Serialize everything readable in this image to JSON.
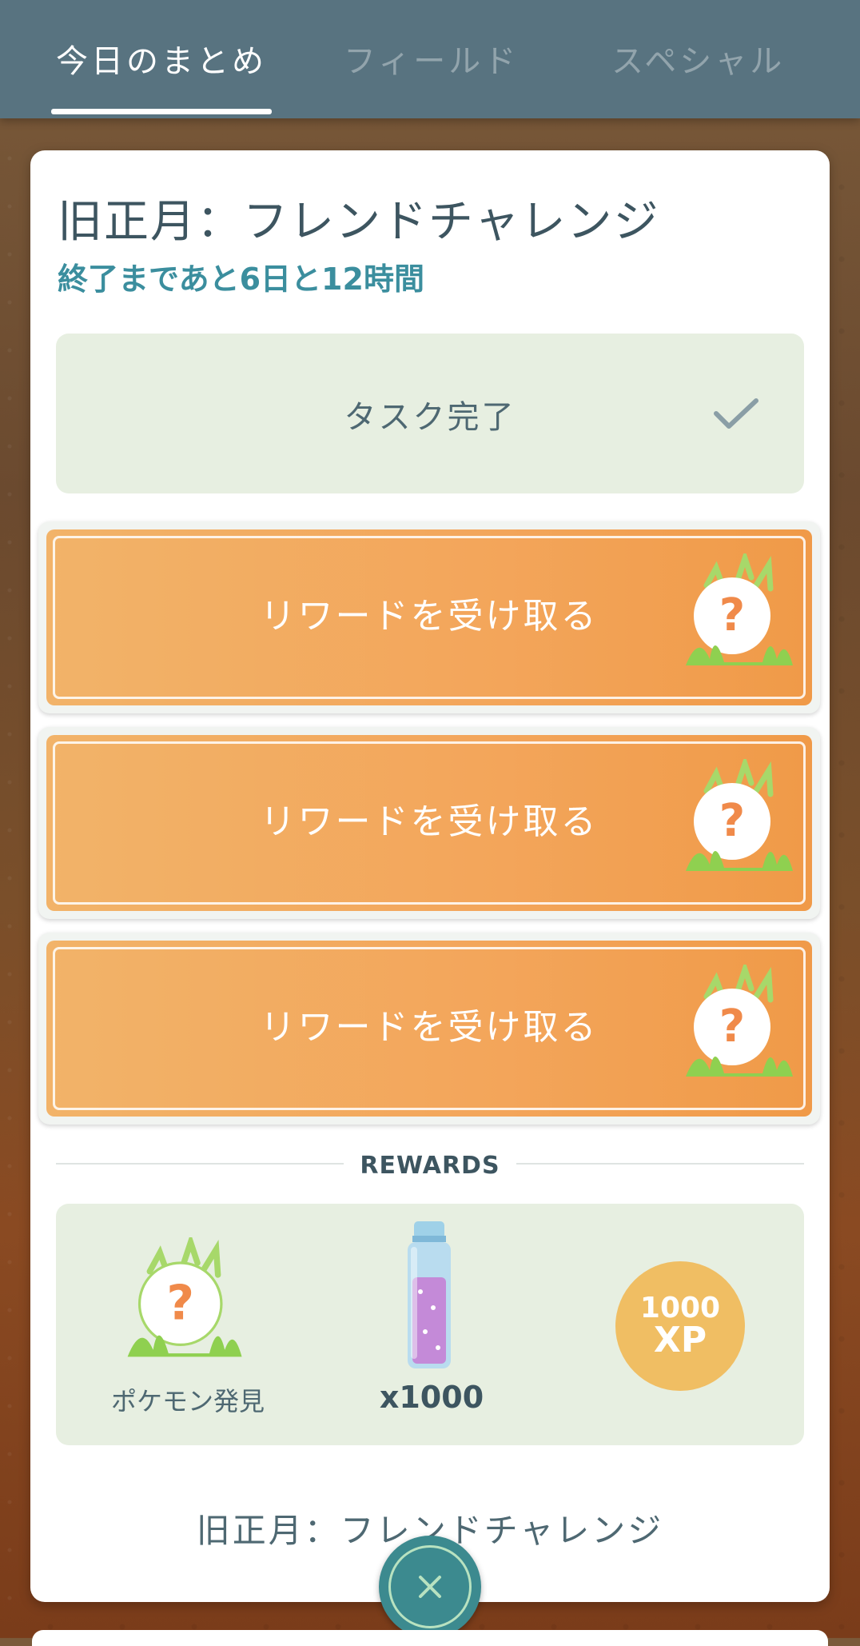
{
  "tabs": [
    {
      "label": "今日のまとめ",
      "active": true
    },
    {
      "label": "フィールド",
      "active": false
    },
    {
      "label": "スペシャル",
      "active": false
    }
  ],
  "card": {
    "title": "旧正月：フレンドチャレンジ",
    "time_remaining": "終了まであと6日と12時間",
    "task_status": "タスク完了",
    "reward_buttons": [
      {
        "label": "リワードを受け取る",
        "icon": "mystery-pokemon-icon"
      },
      {
        "label": "リワードを受け取る",
        "icon": "mystery-pokemon-icon"
      },
      {
        "label": "リワードを受け取る",
        "icon": "mystery-pokemon-icon"
      }
    ],
    "rewards_heading": "REWARDS",
    "rewards": [
      {
        "label": "ポケモン発見",
        "icon": "mystery-pokemon-icon"
      },
      {
        "label": "x1000",
        "icon": "stardust-icon"
      },
      {
        "amount": "1000",
        "unit": "XP",
        "icon": "xp-badge"
      }
    ],
    "footer_title": "旧正月：フレンドチャレンジ"
  },
  "colors": {
    "tab_bar": "#587380",
    "accent_teal": "#3b8e9e",
    "reward_orange": "#f3a55a",
    "xp_gold": "#f0be63",
    "panel_green": "#e7efe1"
  }
}
